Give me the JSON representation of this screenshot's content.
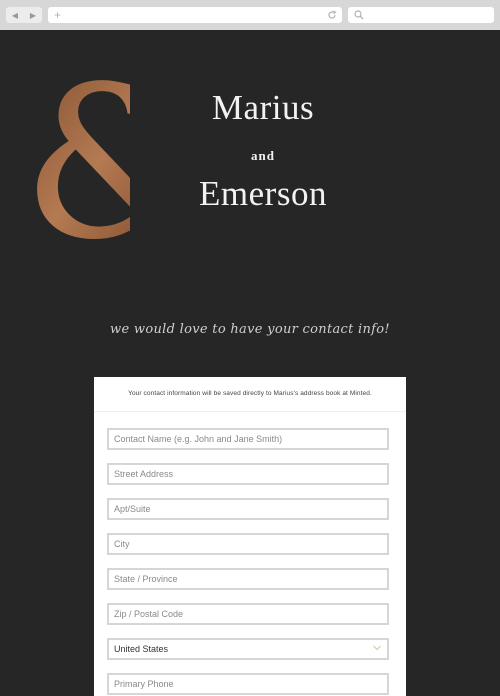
{
  "browser": {
    "back_icon": "back-arrow-icon",
    "forward_icon": "forward-arrow-icon",
    "new_tab_icon": "plus-icon",
    "refresh_icon": "refresh-icon",
    "search_icon": "search-icon"
  },
  "hero": {
    "name1": "Marius",
    "and": "and",
    "name2": "Emerson",
    "tagline": "we would love to have your contact info!",
    "ampersand": "&",
    "accent_color": "#a4673f"
  },
  "form": {
    "note": "Your contact information will be saved directly to Marius's address book at Minted.",
    "fields": {
      "contact_name": "Contact Name (e.g. John and Jane Smith)",
      "street": "Street Address",
      "apt": "Apt/Suite",
      "city": "City",
      "state": "State / Province",
      "zip": "Zip / Postal Code",
      "country": "United States",
      "phone": "Primary Phone"
    }
  }
}
